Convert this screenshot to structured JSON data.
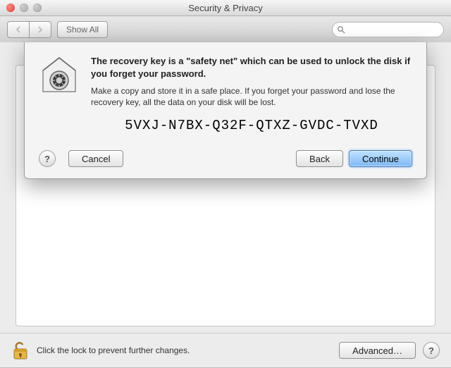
{
  "titlebar": {
    "title": "Security & Privacy"
  },
  "toolbar": {
    "show_all_label": "Show All",
    "search_placeholder": ""
  },
  "sheet": {
    "heading": "The recovery key is a \"safety net\" which can be used to unlock the disk if you forget your password.",
    "subtext": "Make a copy and store it in a safe place. If you forget your password and lose the recovery key, all the data on your disk will be lost.",
    "recovery_key": "5VXJ-N7BX-Q32F-QTXZ-GVDC-TVXD",
    "cancel_label": "Cancel",
    "back_label": "Back",
    "continue_label": "Continue",
    "help_label": "?"
  },
  "bottom": {
    "lock_text": "Click the lock to prevent further changes.",
    "advanced_label": "Advanced…",
    "help_label": "?"
  }
}
